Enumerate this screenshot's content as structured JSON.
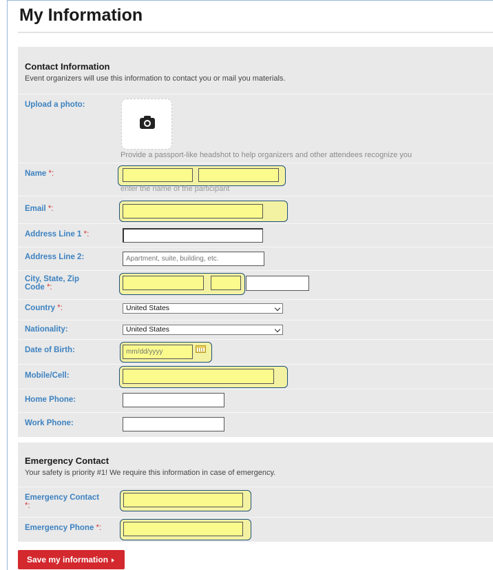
{
  "page_title": "My Information",
  "contact": {
    "title": "Contact Information",
    "description": "Event organizers will use this information to contact you or mail you materials.",
    "photo": {
      "label": "Upload a photo:",
      "hint": "Provide a passport-like headshot to help organizers and other attendees recognize you"
    },
    "name": {
      "label": "Name",
      "req": " *:",
      "hint": "enter the name of the participant",
      "first_value": "",
      "last_value": ""
    },
    "email": {
      "label": "Email",
      "req": " *:",
      "value": ""
    },
    "address1": {
      "label": "Address Line 1",
      "req": " *:",
      "value": ""
    },
    "address2": {
      "label": "Address Line 2:",
      "placeholder": "Apartment, suite, building, etc.",
      "value": ""
    },
    "city_state_zip": {
      "label": "City, State, Zip Code",
      "req": " *:"
    },
    "country": {
      "label": "Country",
      "req": " *:",
      "value": "United States"
    },
    "nationality": {
      "label": "Nationality:",
      "value": "United States"
    },
    "dob": {
      "label": "Date of Birth:",
      "placeholder": "mm/dd/yyyy"
    },
    "mobile": {
      "label": "Mobile/Cell:",
      "value": ""
    },
    "home_phone": {
      "label": "Home Phone:",
      "value": ""
    },
    "work_phone": {
      "label": "Work Phone:",
      "value": ""
    }
  },
  "emergency": {
    "title": "Emergency Contact",
    "description": "Your safety is priority #1! We require this information in case of emergency.",
    "contact": {
      "label": "Emergency Contact",
      "req": " *:",
      "value": ""
    },
    "phone": {
      "label": "Emergency Phone",
      "req": " *:",
      "value": ""
    }
  },
  "save_button": "Save my information",
  "colors": {
    "label_blue": "#3d82c0",
    "highlight": "#f3f2a3",
    "required_red": "#d23a3a",
    "save_red": "#d3282e"
  }
}
